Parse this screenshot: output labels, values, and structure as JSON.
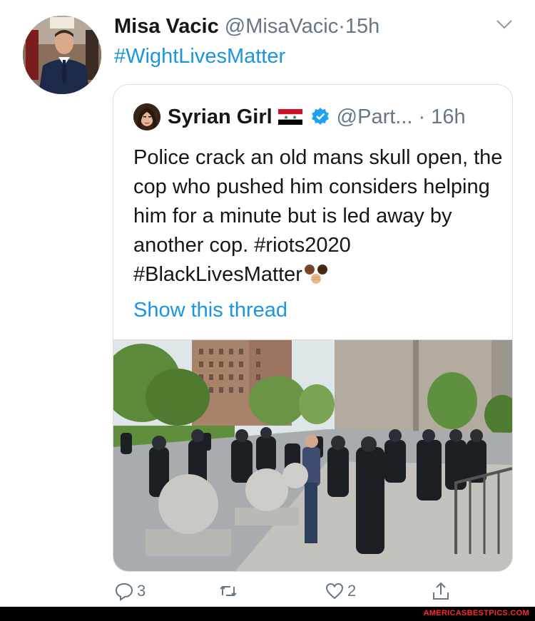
{
  "tweet": {
    "author_name": "Misa Vacic",
    "author_handle": "@MisaVacic",
    "separator": "·",
    "time": "15h",
    "text": "#WightLivesMatter",
    "replies": "3",
    "likes": "2",
    "icons": [
      "chevron-down-icon",
      "reply-icon",
      "retweet-icon",
      "like-icon",
      "share-icon"
    ]
  },
  "quoted": {
    "author_name": "Syrian Girl",
    "handle": "@Part...",
    "separator": "·",
    "time": "16h",
    "text_main": "Police crack an old mans skull open, the cop who pushed him considers helping him for a minute but is led away by another cop.",
    "hashtags": "#riots2020 #BlackLivesMatter",
    "show_thread": "Show this thread",
    "icons": [
      "syria-flag-icon",
      "verified-badge-icon",
      "raised-fists-emoji"
    ]
  },
  "footer": {
    "watermark": "AMERICASBESTPICS.COM"
  },
  "colors": {
    "link_blue": "#1b95e0",
    "secondary_text": "#657786",
    "verified_blue": "#1da1f2",
    "border": "#d7dde2",
    "watermark_red": "#ff2a2a"
  }
}
